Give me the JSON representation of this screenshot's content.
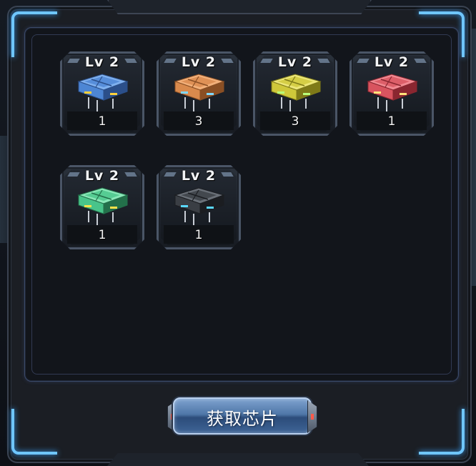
{
  "panel": {
    "accent_color": "#6fc6ff",
    "chips": [
      {
        "level": "Lv 2",
        "count": "1",
        "color": "blue",
        "base": "#4d86d4",
        "light": "#7fb0ee",
        "dark": "#2b4f8a",
        "glow": "#ffd23a"
      },
      {
        "level": "Lv 2",
        "count": "3",
        "color": "orange",
        "base": "#d98a4d",
        "light": "#f2b07a",
        "dark": "#8a4f24",
        "glow": "#7fd8ff"
      },
      {
        "level": "Lv 2",
        "count": "3",
        "color": "yellow",
        "base": "#cfc83a",
        "light": "#ece67a",
        "dark": "#7f7a18",
        "glow": "#b8ff7a"
      },
      {
        "level": "Lv 2",
        "count": "1",
        "color": "red",
        "base": "#d8545f",
        "light": "#f08a92",
        "dark": "#8a2630",
        "glow": "#ffe27a"
      },
      {
        "level": "Lv 2",
        "count": "1",
        "color": "green",
        "base": "#49c48a",
        "light": "#8ae8b8",
        "dark": "#23704a",
        "glow": "#ffe24a"
      },
      {
        "level": "Lv 2",
        "count": "1",
        "color": "black",
        "base": "#3a3e44",
        "light": "#6a7078",
        "dark": "#1b1d21",
        "glow": "#5ad8ff"
      }
    ]
  },
  "button": {
    "label": "获取芯片"
  }
}
